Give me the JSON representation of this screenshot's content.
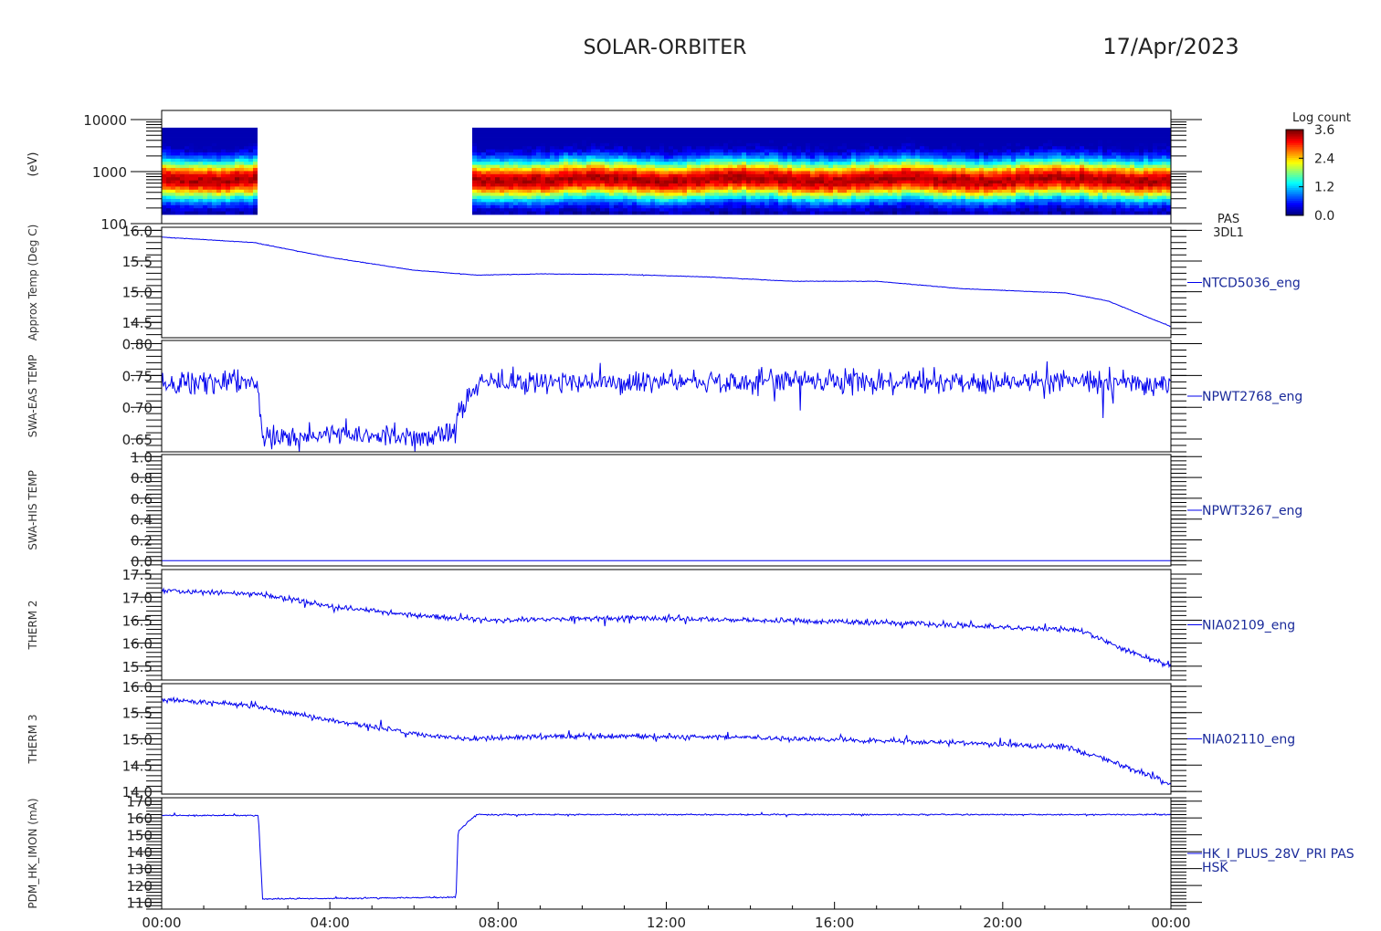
{
  "header": {
    "mission": "SOLAR-ORBITER",
    "date": "17/Apr/2023"
  },
  "chart_data": {
    "type": "line",
    "x_ticks": [
      "00:00",
      "04:00",
      "08:00",
      "12:00",
      "16:00",
      "20:00",
      "00:00"
    ],
    "x_range_hours": [
      0,
      24
    ],
    "line_color": "#0000ee",
    "spectrogram": {
      "type": "heatmap",
      "label_top": "PAS",
      "label_bottom": "3DL1",
      "y_scale": "log",
      "ylim": [
        100,
        15000
      ],
      "y_ticks": [
        100,
        1000,
        10000
      ],
      "ylabel": "(eV)",
      "colorbar_title": "Log count",
      "colorbar_ticks": [
        0.0,
        1.2,
        2.4,
        3.6
      ],
      "data_gap_hours": [
        2.35,
        7.3
      ],
      "energy_band": [
        150,
        7000
      ],
      "peak_energy": 700,
      "peak_log_count": 3.6
    },
    "panels": [
      {
        "name": "NTCD5036_eng",
        "ylabel": "Approx Temp (Deg C)",
        "ylim": [
          14.25,
          16.05
        ],
        "y_ticks": [
          "16.0",
          "15.5",
          "15.0",
          "14.5"
        ],
        "trend": [
          [
            0,
            15.89
          ],
          [
            2.2,
            15.8
          ],
          [
            4,
            15.56
          ],
          [
            6,
            15.35
          ],
          [
            7.5,
            15.27
          ],
          [
            9,
            15.29
          ],
          [
            11,
            15.28
          ],
          [
            13,
            15.24
          ],
          [
            15,
            15.17
          ],
          [
            17,
            15.17
          ],
          [
            19,
            15.05
          ],
          [
            21.5,
            14.98
          ],
          [
            22.5,
            14.85
          ],
          [
            24,
            14.43
          ]
        ],
        "noise": 0.004
      },
      {
        "name": "NPWT2768_eng",
        "ylabel": "SWA-EAS TEMP",
        "ylim": [
          0.63,
          0.805
        ],
        "y_ticks": [
          "0.80",
          "0.75",
          "0.70",
          "0.65"
        ],
        "trend": [
          [
            0,
            0.74
          ],
          [
            2.28,
            0.74
          ],
          [
            2.4,
            0.655
          ],
          [
            7.0,
            0.655
          ],
          [
            7.05,
            0.7
          ],
          [
            7.3,
            0.715
          ],
          [
            7.6,
            0.74
          ],
          [
            24,
            0.74
          ]
        ],
        "noise": 0.018
      },
      {
        "name": "NPWT3267_eng",
        "ylabel": "SWA-HIS TEMP",
        "ylim": [
          -0.05,
          1.02
        ],
        "y_ticks": [
          "1.0",
          "0.8",
          "0.6",
          "0.4",
          "0.2",
          "0.0"
        ],
        "trend": [
          [
            0,
            0.0
          ],
          [
            24,
            0.0
          ]
        ],
        "noise": 0.0
      },
      {
        "name": "NIA02109_eng",
        "ylabel": "THERM 2",
        "ylim": [
          15.2,
          17.6
        ],
        "y_ticks": [
          "17.5",
          "17.0",
          "16.5",
          "16.0",
          "15.5"
        ],
        "trend": [
          [
            0,
            17.15
          ],
          [
            2.5,
            17.05
          ],
          [
            4,
            16.8
          ],
          [
            6,
            16.6
          ],
          [
            8,
            16.5
          ],
          [
            11,
            16.55
          ],
          [
            14,
            16.5
          ],
          [
            17,
            16.45
          ],
          [
            20,
            16.35
          ],
          [
            21.8,
            16.3
          ],
          [
            22.8,
            15.9
          ],
          [
            24,
            15.5
          ]
        ],
        "noise": 0.06
      },
      {
        "name": "NIA02110_eng",
        "ylabel": "THERM 3",
        "ylim": [
          13.95,
          16.05
        ],
        "y_ticks": [
          "16.0",
          "15.5",
          "15.0",
          "14.5",
          "14.0"
        ],
        "trend": [
          [
            0,
            15.75
          ],
          [
            2,
            15.65
          ],
          [
            4,
            15.35
          ],
          [
            6,
            15.1
          ],
          [
            7.3,
            15.0
          ],
          [
            9,
            15.05
          ],
          [
            12,
            15.05
          ],
          [
            15,
            15.0
          ],
          [
            18,
            14.95
          ],
          [
            21.5,
            14.85
          ],
          [
            22.5,
            14.6
          ],
          [
            24,
            14.15
          ]
        ],
        "noise": 0.05
      },
      {
        "name": "HK_I_PLUS_28V_PRI PAS",
        "name2": "HSK",
        "ylabel": "PDM_HK_IMON (mA)",
        "ylim": [
          106,
          172
        ],
        "y_ticks": [
          "170",
          "160",
          "150",
          "140",
          "130",
          "120",
          "110"
        ],
        "trend": [
          [
            0,
            161.5
          ],
          [
            2.3,
            161.5
          ],
          [
            2.4,
            112
          ],
          [
            7.0,
            113
          ],
          [
            7.05,
            152
          ],
          [
            7.3,
            158
          ],
          [
            7.5,
            162
          ],
          [
            24,
            162
          ]
        ],
        "noise": 0.4
      }
    ]
  }
}
